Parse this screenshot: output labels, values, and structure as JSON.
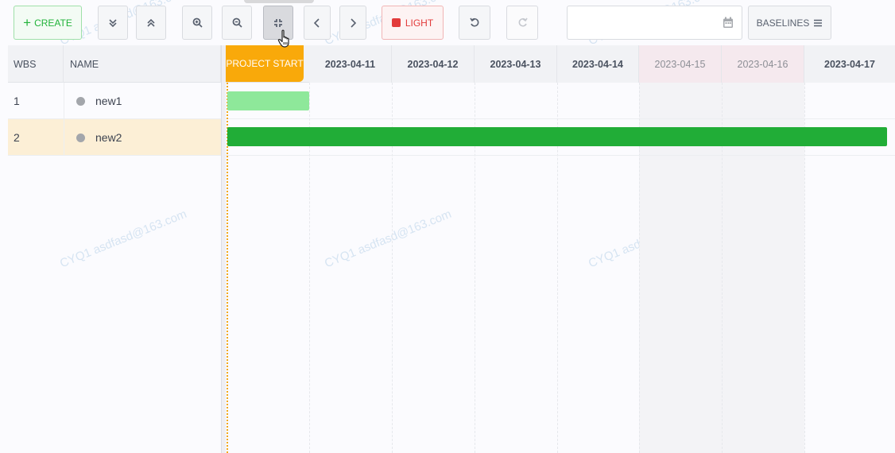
{
  "toolbar": {
    "create_label": "CREATE",
    "light_label": "LIGHT",
    "baselines_label": "BASELINES",
    "date_value": ""
  },
  "grid": {
    "columns": [
      "WBS",
      "NAME"
    ],
    "rows": [
      {
        "wbs": "1",
        "name": "new1"
      },
      {
        "wbs": "2",
        "name": "new2"
      }
    ]
  },
  "timeline": {
    "project_start_label": "PROJECT START",
    "dates": [
      "2023-04-11",
      "2023-04-12",
      "2023-04-13",
      "2023-04-14",
      "2023-04-15",
      "2023-04-16",
      "2023-04-17"
    ],
    "weekend_dates": [
      "2023-04-15",
      "2023-04-16"
    ]
  },
  "watermark": "CYQ1 asdfasd@163.com",
  "colors": {
    "create": "#22b33a",
    "light": "#e23b3b",
    "project_start": "#f9a90a",
    "task1_bar": "#8ee89a",
    "task2_bar": "#21ad37",
    "selected_row": "#fcefd6"
  }
}
